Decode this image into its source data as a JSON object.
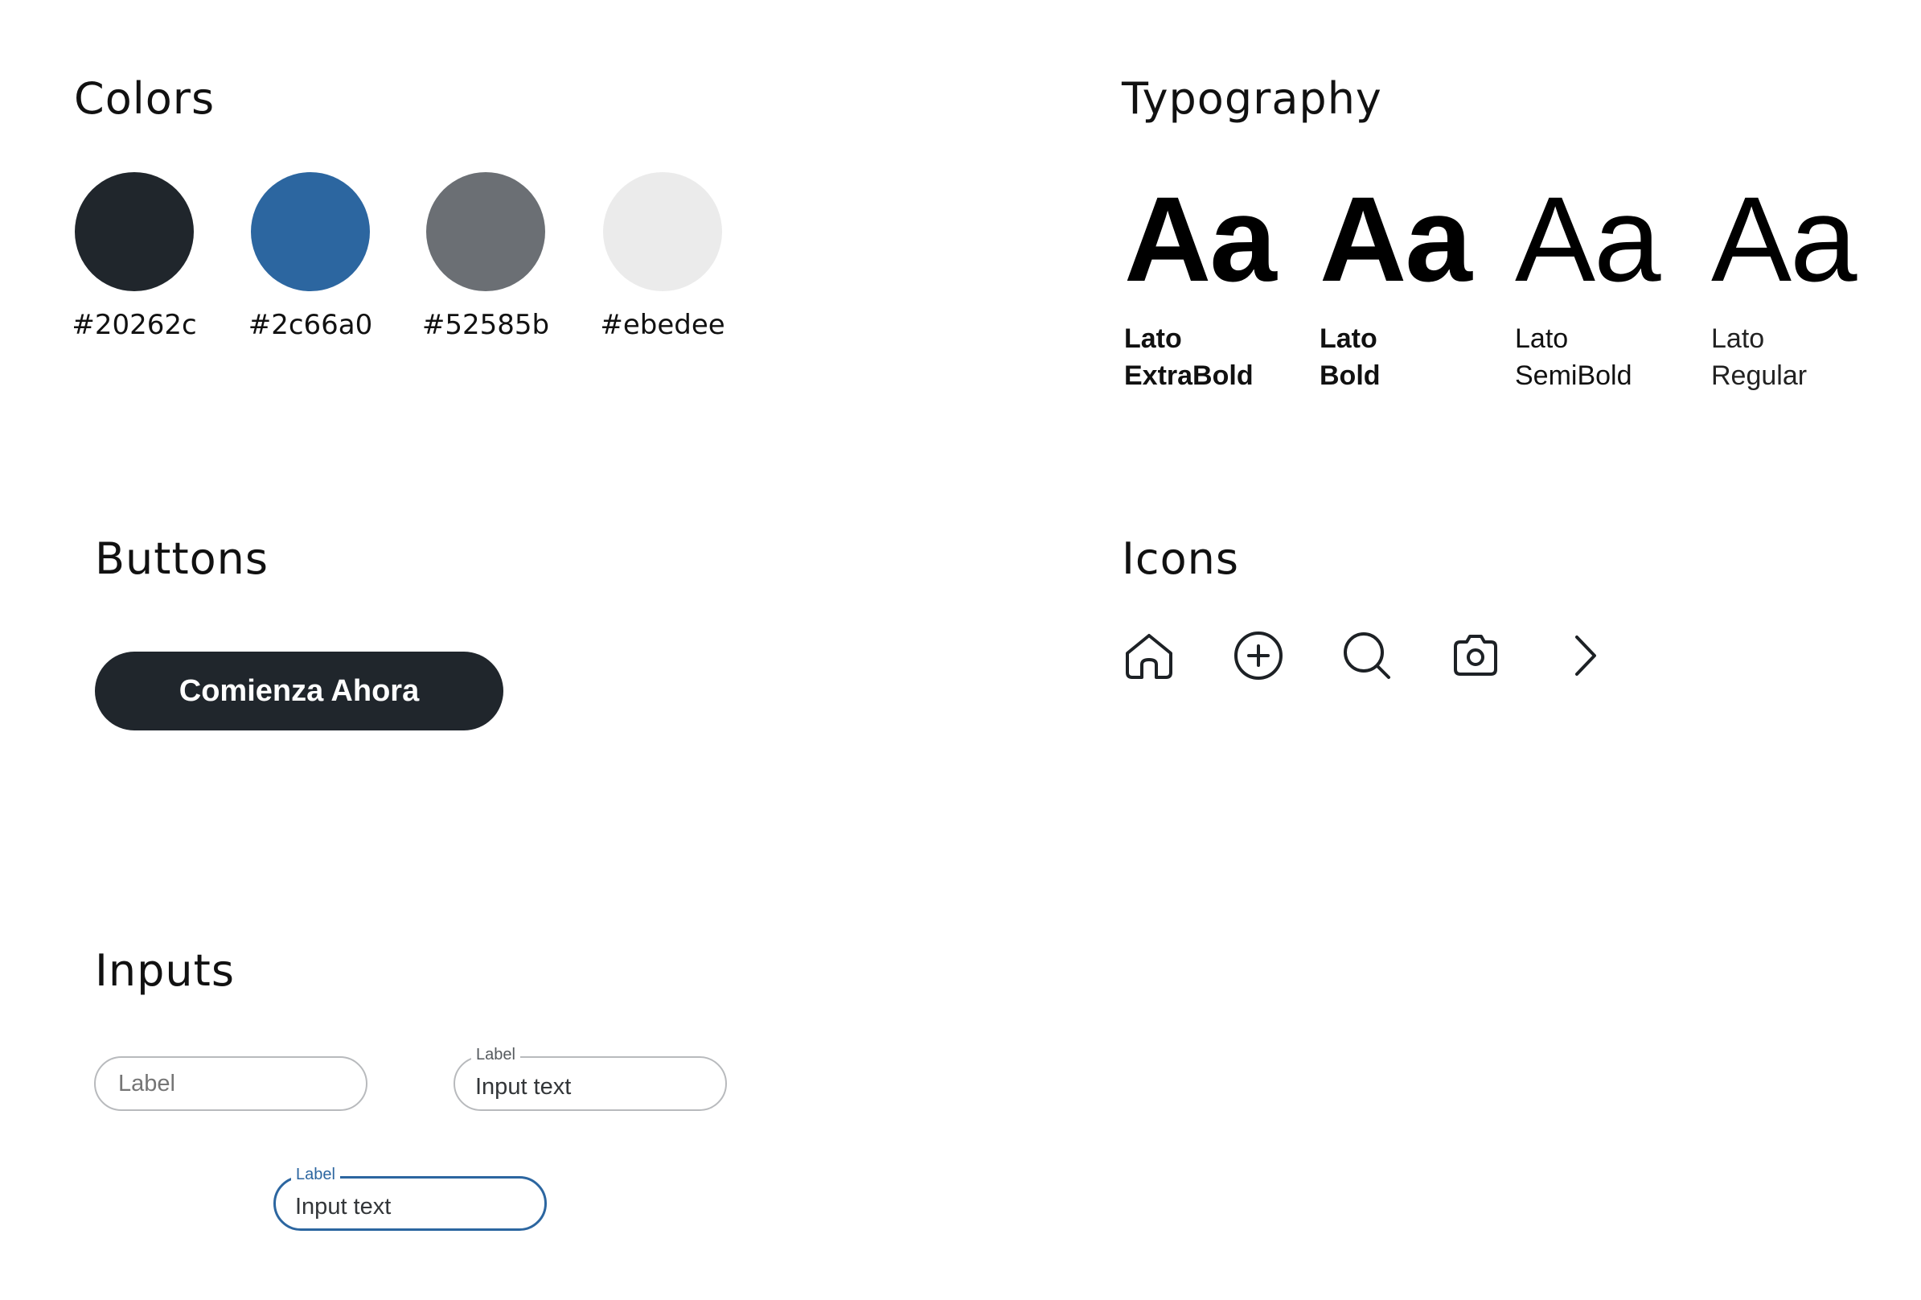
{
  "sections": {
    "colors_title": "Colors",
    "typography_title": "Typography",
    "buttons_title": "Buttons",
    "icons_title": "Icons",
    "inputs_title": "Inputs"
  },
  "colors": [
    {
      "label": "#20262c",
      "hex": "#20262c"
    },
    {
      "label": "#2c66a0",
      "hex": "#2c66a0"
    },
    {
      "label": "#52585b",
      "hex": "#6b6f74"
    },
    {
      "label": "#ebedee",
      "hex": "#ebebeb"
    }
  ],
  "typography": [
    {
      "sample": "Aa",
      "family": "Lato",
      "weight": "ExtraBold"
    },
    {
      "sample": "Aa",
      "family": "Lato",
      "weight": "Bold"
    },
    {
      "sample": "Aa",
      "family": "Lato",
      "weight": "SemiBold"
    },
    {
      "sample": "Aa",
      "family": "Lato",
      "weight": "Regular"
    }
  ],
  "buttons": {
    "primary_label": "Comienza Ahora",
    "primary_color": "#20262c"
  },
  "icons": [
    "home-icon",
    "plus-circle-icon",
    "search-icon",
    "camera-icon",
    "chevron-right-icon"
  ],
  "inputs": {
    "empty": {
      "placeholder": "Label"
    },
    "filled": {
      "label": "Label",
      "value": "Input text"
    },
    "focused": {
      "label": "Label",
      "value": "Input text",
      "accent": "#2c66a0"
    }
  }
}
